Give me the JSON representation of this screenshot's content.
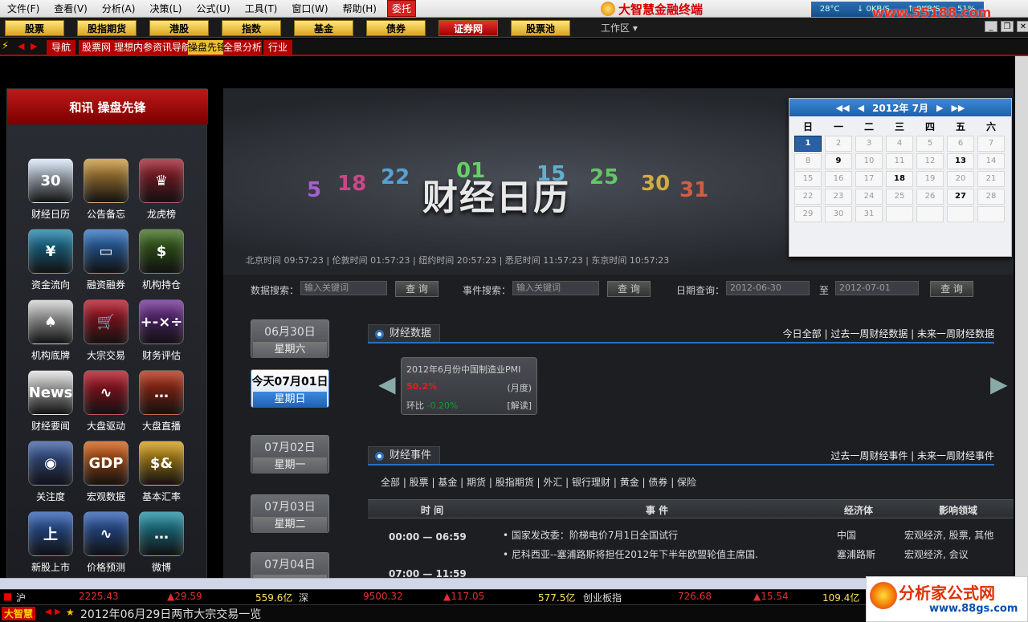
{
  "menu": [
    "文件(F)",
    "查看(V)",
    "分析(A)",
    "决策(L)",
    "公式(U)",
    "工具(T)",
    "窗口(W)",
    "帮助(H)"
  ],
  "weituo": "委托",
  "app_title": "大智慧金融终端",
  "net": {
    "temp": "28°C",
    "down": "0KB/S",
    "up": "0KB/S",
    "pct": "51%"
  },
  "site_top": "www.55188.com",
  "tabs1": [
    "股票",
    "股指期货",
    "港股",
    "指数",
    "基金",
    "债券",
    "证券网",
    "股票池"
  ],
  "workarea": "工作区",
  "tabs2": [
    "导航",
    "股票网",
    "理想内参",
    "资讯导航",
    "操盘先锋",
    "全景分析",
    "行业"
  ],
  "brand": "和讯 操盘先锋",
  "icons": [
    {
      "label": "财经日历",
      "glyph": "30",
      "color": "#d8e6f6"
    },
    {
      "label": "公告备忘",
      "glyph": "",
      "color": "#c9943a"
    },
    {
      "label": "龙虎榜",
      "glyph": "♛",
      "color": "#9b1b2a"
    },
    {
      "label": "资金流向",
      "glyph": "¥",
      "color": "#1a7fa8"
    },
    {
      "label": "融资融券",
      "glyph": "▭",
      "color": "#2a6fc0"
    },
    {
      "label": "机构持仓",
      "glyph": "$",
      "color": "#3a6a1a"
    },
    {
      "label": "机构底牌",
      "glyph": "♠",
      "color": "#d0d0d0"
    },
    {
      "label": "大宗交易",
      "glyph": "🛒",
      "color": "#b01020"
    },
    {
      "label": "财务评估",
      "glyph": "+-×÷",
      "color": "#6a2a90"
    },
    {
      "label": "财经要闻",
      "glyph": "News",
      "color": "#e0e0e0"
    },
    {
      "label": "大盘驱动",
      "glyph": "∿",
      "color": "#b01020"
    },
    {
      "label": "大盘直播",
      "glyph": "…",
      "color": "#b02a10"
    },
    {
      "label": "关注度",
      "glyph": "◉",
      "color": "#3a5aa0"
    },
    {
      "label": "宏观数据",
      "glyph": "GDP",
      "color": "#d05a10"
    },
    {
      "label": "基本汇率",
      "glyph": "$&",
      "color": "#d09a10"
    },
    {
      "label": "新股上市",
      "glyph": "上",
      "color": "#2a5ab0"
    },
    {
      "label": "价格预测",
      "glyph": "∿",
      "color": "#2a5ab0"
    },
    {
      "label": "微博",
      "glyph": "…",
      "color": "#1a8aa0"
    }
  ],
  "banner": {
    "title": "财经日历",
    "clocks": "北京时间 09:57:23 | 伦敦时间 01:57:23 | 纽约时间 20:57:23 | 悉尼时间 11:57:23 | 东京时间 10:57:23"
  },
  "calendar": {
    "month": "2012年 7月",
    "weekdays": [
      "日",
      "一",
      "二",
      "三",
      "四",
      "五",
      "六"
    ],
    "weeks": [
      [
        "1",
        "2",
        "3",
        "4",
        "5",
        "6",
        "7"
      ],
      [
        "8",
        "9",
        "10",
        "11",
        "12",
        "13",
        "14"
      ],
      [
        "15",
        "16",
        "17",
        "18",
        "19",
        "20",
        "21"
      ],
      [
        "22",
        "23",
        "24",
        "25",
        "26",
        "27",
        "28"
      ],
      [
        "29",
        "30",
        "31",
        "",
        "",
        "",
        ""
      ]
    ],
    "marked": [
      "1",
      "9",
      "13",
      "18",
      "27"
    ],
    "selected": "1"
  },
  "search": {
    "data_label": "数据搜索：",
    "data_ph": "输入关键词",
    "btn": "查 询",
    "event_label": "事件搜索：",
    "event_ph": "输入关键词",
    "date_label": "日期查询：",
    "from": "2012-06-30",
    "to_label": "至",
    "to": "2012-07-01"
  },
  "dates": [
    {
      "d1": "06月30日",
      "d2": "星期六",
      "today": false
    },
    {
      "d1": "今天07月01日",
      "d2": "星期日",
      "today": true
    },
    {
      "d1": "07月02日",
      "d2": "星期一",
      "today": false
    },
    {
      "d1": "07月03日",
      "d2": "星期二",
      "today": false
    },
    {
      "d1": "07月04日",
      "d2": "",
      "today": false
    }
  ],
  "data_section": {
    "title": "财经数据",
    "links": "今日全部 | 过去一周财经数据 | 未来一周财经数据"
  },
  "pmi": {
    "title": "2012年6月份中国制造业PMI",
    "value": "50.2%",
    "period": "(月度)",
    "hb_label": "环比",
    "hb": "-0.20%",
    "jiedu": "[解读]"
  },
  "event_section": {
    "title": "财经事件",
    "links": "过去一周财经事件 | 未来一周财经事件"
  },
  "categories": "全部 | 股票 | 基金 | 期货 | 股指期货 | 外汇 | 银行理财 | 黄金 | 债券 | 保险",
  "event_cols": [
    "时 间",
    "事 件",
    "经济体",
    "影响领域"
  ],
  "events": [
    {
      "time": "00:00 — 06:59",
      "event": "• 国家发改委：阶梯电价7月1日全国试行",
      "econ": "中国",
      "area": "宏观经济, 股票, 其他"
    },
    {
      "time": "",
      "event": "• 尼科西亚--塞浦路斯将担任2012年下半年欧盟轮值主席国.",
      "econ": "塞浦路斯",
      "area": "宏观经济, 会议"
    },
    {
      "time": "07:00 — 11:59",
      "event": "",
      "econ": "",
      "area": ""
    }
  ],
  "status": {
    "sh": "沪",
    "sh_idx": "2225.43",
    "sh_chg": "▲29.59",
    "sh_amt": "559.6亿",
    "sz": "深",
    "sz_idx": "9500.32",
    "sz_chg": "▲117.05",
    "sz_amt": "577.5亿",
    "cy": "创业板指",
    "cy_idx": "726.68",
    "cy_chg": "▲15.54",
    "cy_amt": "109.4亿"
  },
  "ticker_brand": "大智慧",
  "ticker": "2012年06月29日两市大宗交易一览",
  "logo2": {
    "a": "分析家公式网",
    "b": "www.88gs.com"
  }
}
